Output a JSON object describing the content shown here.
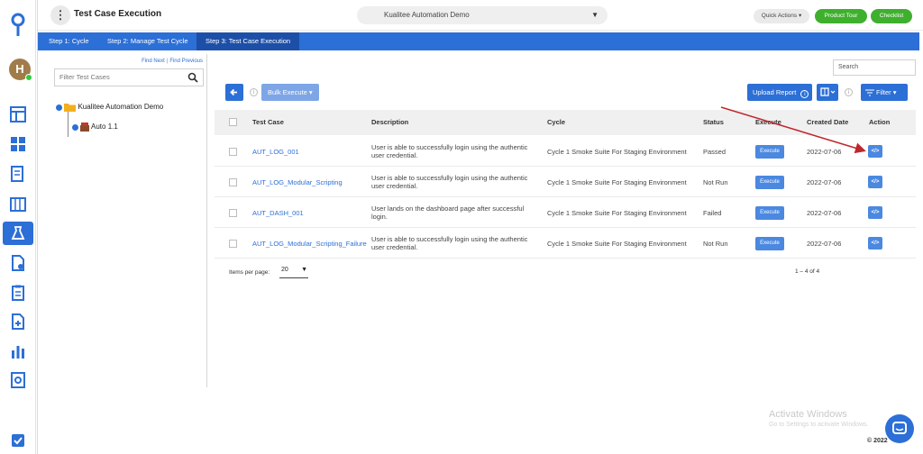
{
  "header": {
    "title": "Test Case Execution",
    "project": "Kualitee Automation Demo",
    "quick_actions": "Quick Actions",
    "product_tour": "Product Tour",
    "checklist": "Checklist"
  },
  "sidebar": {
    "avatar_letter": "H",
    "items": [
      "dashboard-icon",
      "modules-icon",
      "requirements-icon",
      "test-cases-icon",
      "test-execution-icon",
      "reports-icon",
      "clipboard-icon",
      "defects-icon",
      "analytics-icon",
      "settings-icon",
      "tasks-icon"
    ],
    "active_index": 4
  },
  "steps": [
    {
      "label": "Step 1: Cycle",
      "active": false
    },
    {
      "label": "Step 2: Manage Test Cycle",
      "active": false
    },
    {
      "label": "Step 3: Test Case Execution",
      "active": true
    }
  ],
  "tree": {
    "find_next": "Find Next",
    "find_previous": "Find Previous",
    "filter_placeholder": "Filter Test Cases",
    "root": "Kualitee Automation Demo",
    "child": "Auto 1.1"
  },
  "toolbar": {
    "search_placeholder": "Search",
    "bulk_execute": "Bulk Execute",
    "upload_report": "Upload Report",
    "filter": "Filter"
  },
  "table": {
    "columns": [
      "Test Case",
      "Description",
      "Cycle",
      "Status",
      "Execute",
      "Created Date",
      "Action"
    ],
    "rows": [
      {
        "test_case": "AUT_LOG_001",
        "description": "User is able to successfully login using the authentic user credential.",
        "cycle": "Cycle 1 Smoke Suite For Staging Environment",
        "status": "Passed",
        "execute": "Execute",
        "created": "2022-07-06",
        "action": "</>"
      },
      {
        "test_case": "AUT_LOG_Modular_Scripting",
        "description": "User is able to successfully login using the authentic user credential.",
        "cycle": "Cycle 1 Smoke Suite For Staging Environment",
        "status": "Not Run",
        "execute": "Execute",
        "created": "2022-07-06",
        "action": "</>"
      },
      {
        "test_case": "AUT_DASH_001",
        "description": "User lands on the dashboard page after successful login.",
        "cycle": "Cycle 1 Smoke Suite For Staging Environment",
        "status": "Failed",
        "execute": "Execute",
        "created": "2022-07-06",
        "action": "</>"
      },
      {
        "test_case": "AUT_LOG_Modular_Scripting_Failure",
        "description": "User is able to successfully login using the authentic user credential.",
        "cycle": "Cycle 1 Smoke Suite For Staging Environment",
        "status": "Not Run",
        "execute": "Execute",
        "created": "2022-07-06",
        "action": "</>"
      }
    ]
  },
  "pagination": {
    "items_per_page_label": "Items per page:",
    "items_per_page": "20",
    "range": "1 – 4 of 4"
  },
  "footer": {
    "watermark_title": "Activate Windows",
    "watermark_sub": "Go to Settings to activate Windows.",
    "copyright": "© 2022"
  },
  "colors": {
    "primary": "#2c6fd6",
    "step_active": "#1d4fa8",
    "green": "#3fb02e",
    "annotation_arrow": "#c0272d"
  }
}
